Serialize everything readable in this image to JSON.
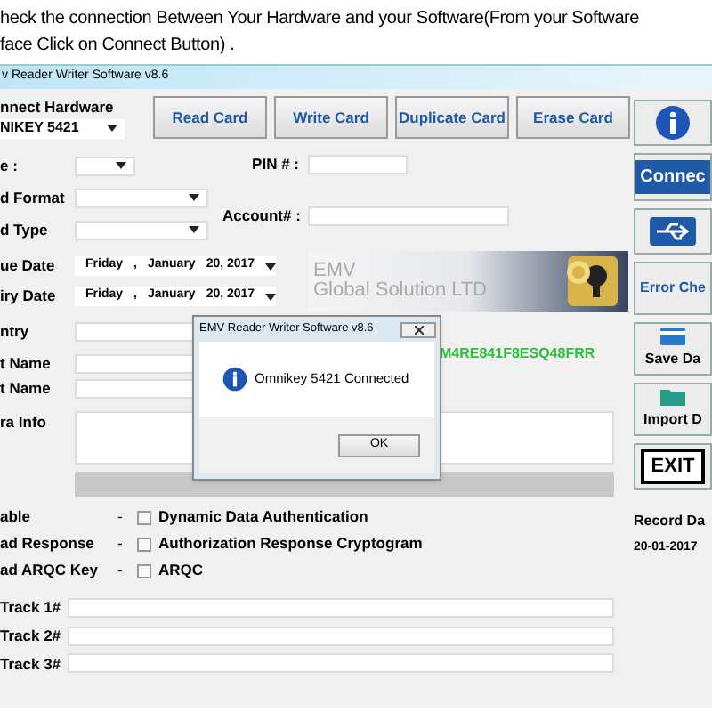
{
  "instruction": [
    "heck the connection Between Your Hardware and your Software(From your Software",
    "face Click on Connect Button) ."
  ],
  "window": {
    "title": "v Reader Writer Software v8.6"
  },
  "hardware": {
    "label": "nnect Hardware",
    "value": "NIKEY 5421"
  },
  "actions": [
    "Read Card",
    "Write Card",
    "Duplicate Card",
    "Erase Card"
  ],
  "form": [
    {
      "kind": "short-select",
      "label": "e :"
    },
    {
      "kind": "long-select",
      "label": "d Format"
    },
    {
      "kind": "long-select",
      "label": "d Type"
    }
  ],
  "pin": {
    "label": "PIN # :"
  },
  "account": {
    "label": "Account# :"
  },
  "dates": [
    {
      "label": "ue Date",
      "day": "Friday",
      "sep": ",",
      "month": "January",
      "date": "20, 2017"
    },
    {
      "label": "iry Date",
      "day": "Friday",
      "sep": ",",
      "month": "January",
      "date": "20, 2017"
    }
  ],
  "names": [
    "ntry",
    "t Name",
    "t Name"
  ],
  "extra": {
    "label": "ra Info"
  },
  "banner": {
    "line1": "EMV",
    "line2": "Global Solution LTD"
  },
  "code": "M4RE841F8ESQ48FRR",
  "options": [
    {
      "label": "able",
      "dash": "-",
      "option": "Dynamic Data Authentication",
      "checked": false
    },
    {
      "label": "ad Response",
      "dash": "-",
      "option": "Authorization Response Cryptogram",
      "checked": false
    },
    {
      "label": "ad ARQC Key",
      "dash": "-",
      "option": "ARQC",
      "checked": false
    }
  ],
  "tracks": [
    "Track 1#",
    "Track 2#",
    "Track 3#"
  ],
  "side": [
    {
      "kind": "info"
    },
    {
      "kind": "connect",
      "label": "Connec"
    },
    {
      "kind": "usb"
    },
    {
      "kind": "text",
      "label": "Error Che"
    },
    {
      "kind": "save",
      "label": "Save Da"
    },
    {
      "kind": "import",
      "label": "Import D"
    },
    {
      "kind": "exit",
      "label": "EXIT"
    }
  ],
  "record": {
    "label": "Record Da",
    "value": "20-01-2017"
  },
  "dialog": {
    "title": "EMV Reader Writer Software v8.6",
    "message": "Omnikey 5421 Connected",
    "button": "OK"
  }
}
